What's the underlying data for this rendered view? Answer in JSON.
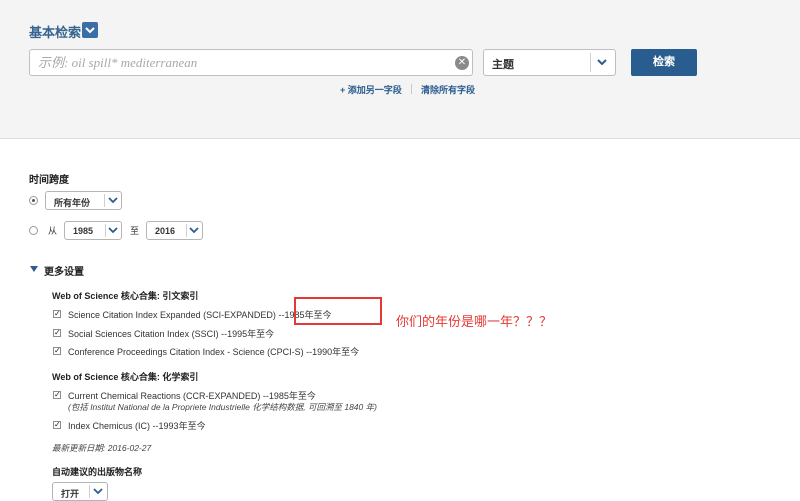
{
  "header": {
    "title": "基本检索",
    "search_placeholder": "示例: oil spill* mediterranean",
    "field_select": "主题",
    "search_button": "检索",
    "add_field": "+ 添加另一字段",
    "clear_fields": "清除所有字段"
  },
  "timespan": {
    "label": "时间跨度",
    "all_years": "所有年份",
    "from_label": "从",
    "from_year": "1985",
    "to_label": "至",
    "to_year": "2016"
  },
  "more_settings": {
    "label": "更多设置",
    "group1_title": "Web of Science 核心合集: 引文索引",
    "group1_items": [
      {
        "name": "Science Citation Index Expanded (SCI-EXPANDED)",
        "range": "--1985年至今"
      },
      {
        "name": "Social Sciences Citation Index (SSCI)",
        "range": "--1995年至今"
      },
      {
        "name": "Conference Proceedings Citation Index - Science (CPCI-S)",
        "range": "--1990年至今"
      }
    ],
    "group2_title": "Web of Science 核心合集: 化学索引",
    "group2_items": [
      {
        "name": "Current Chemical Reactions (CCR-EXPANDED)",
        "range": "--1985年至今",
        "note": "(包括 Institut National de la Propriete Industrielle 化学结构数据, 可回溯至 1840 年)"
      },
      {
        "name": "Index Chemicus (IC)",
        "range": "--1993年至今"
      }
    ],
    "last_updated": "最新更新日期: 2016-02-27",
    "auto_suggest_label": "自动建议的出版物名称",
    "auto_suggest_value": "打开"
  },
  "annotation": "你们的年份是哪一年？？？",
  "colors": {
    "accent": "#2a5d8f",
    "annotation": "#e53935"
  }
}
